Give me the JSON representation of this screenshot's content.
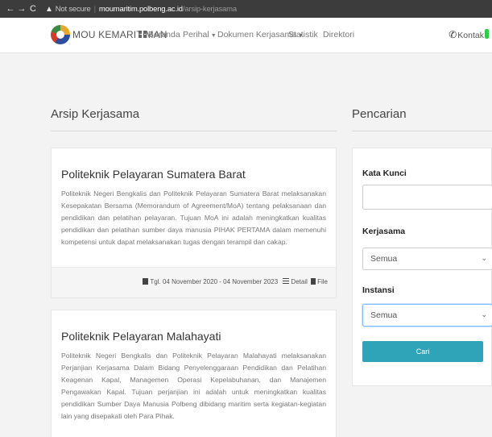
{
  "browser": {
    "back": "←",
    "forward": "→",
    "reload": "C",
    "warning_icon": "warning-triangle",
    "not_secure": "Not secure",
    "separator": "|",
    "host": "moumaritim.polbeng.ac.id",
    "path": "/arsip-kerjasama"
  },
  "nav": {
    "brand": "MOU KEMARITIMAN",
    "items": [
      {
        "label": "Beranda",
        "icon": "grid-icon",
        "dropdown": false
      },
      {
        "label": "Perihal",
        "dropdown": true
      },
      {
        "label": "Dokumen Kerjasama",
        "dropdown": true
      },
      {
        "label": "Statistik",
        "dropdown": false
      },
      {
        "label": "Direktori",
        "dropdown": false
      }
    ],
    "contact": "Kontak",
    "contact_icon": "phone-icon"
  },
  "main": {
    "title": "Arsip Kerjasama",
    "cards": [
      {
        "title": "Politeknik Pelayaran Sumatera Barat",
        "body": "Politeknik Negeri Bengkalis dan Politeknik Pelayaran Sumatera Barat melaksanakan Kesepakatan Bersama (Memorandum of Agreement/MoA) tentang pelaksanaan dan pendidikan dan pelatihan pelayaran. Tujuan MoA ini adalah meningkatkan kualitas pendidikan dan pelatihan sumber daya manusia PIHAK PERTAMA dalam memenuhi kompetensi untuk dapat melaksanakan tugas dengan terampil dan cakap.",
        "date": "Tgl. 04 November 2020 - 04 November 2023",
        "detail": "Detail",
        "file": "File"
      },
      {
        "title": "Politeknik Pelayaran Malahayati",
        "body": "Politeknik Negeri Bengkalis dan Politeknik Pelayaran Malahayati melaksanakan Perjanjian Kerjasama Dalam Bidang Penyelenggaraan Pendidikan dan Pelatihan Keagenan Kapal, Managemen Operasi Kepelabuhanan, dan Manajemen Pengawakan Kapal. Tujuan perjanjian ini adalah untuk meningkatkan kualitas pendidikan Sumber Daya Manusia Polbeng dibidang maritim serta kegiatan-kegiatan lain yang disepakati oleh Para Pihak."
      }
    ]
  },
  "sidebar": {
    "title": "Pencarian",
    "keyword_label": "Kata Kunci",
    "keyword_value": "",
    "kerjasama_label": "Kerjasama",
    "kerjasama_value": "Semua",
    "instansi_label": "Instansi",
    "instansi_value": "Semua",
    "search_button": "Cari"
  }
}
